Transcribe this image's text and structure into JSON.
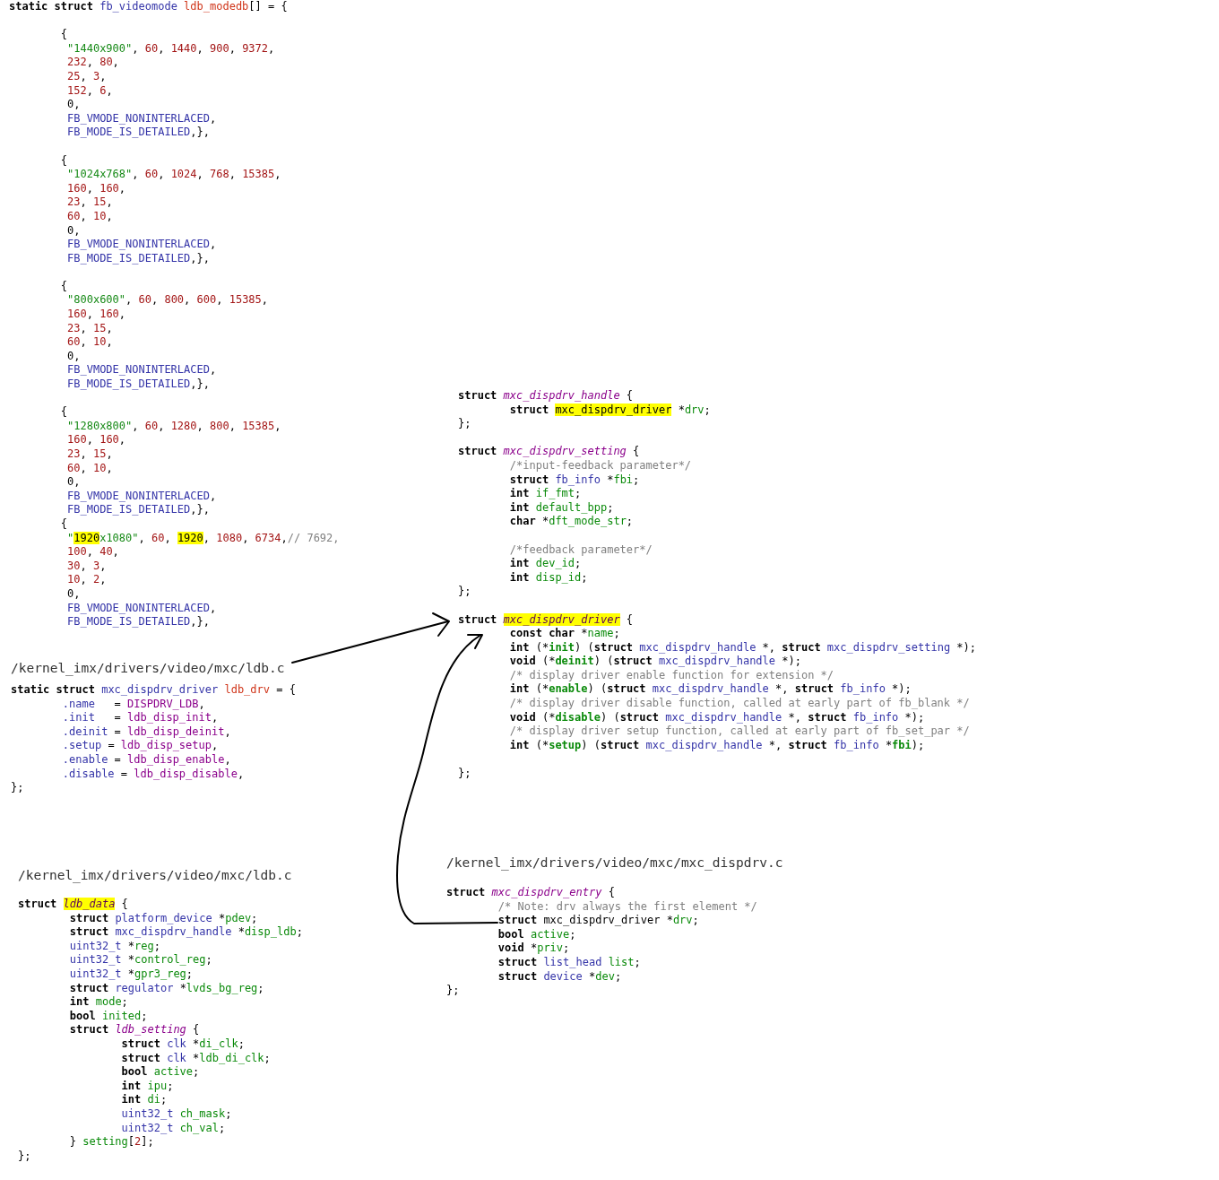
{
  "snippets": [
    {
      "groups": [
        [
          [
            {
              "text": "static struct ",
              "kind": "kw"
            },
            {
              "text": "fb_videomode ",
              "kind": "type"
            },
            {
              "text": "ldb_modedb",
              "kind": "decl"
            },
            {
              "text": "[] = {",
              "kind": "plain"
            }
          ]
        ],
        [
          [
            {
              "text": "        {",
              "kind": "plain"
            }
          ],
          [
            {
              "text": "         \"1440x900\"",
              "kind": "str"
            },
            {
              "text": ", ",
              "kind": "plain"
            },
            {
              "text": "60",
              "kind": "num"
            },
            {
              "text": ", ",
              "kind": "plain"
            },
            {
              "text": "1440",
              "kind": "num"
            },
            {
              "text": ", ",
              "kind": "plain"
            },
            {
              "text": "900",
              "kind": "num"
            },
            {
              "text": ", ",
              "kind": "plain"
            },
            {
              "text": "9372",
              "kind": "num"
            },
            {
              "text": ",",
              "kind": "plain"
            }
          ],
          [
            {
              "text": "         232",
              "kind": "num"
            },
            {
              "text": ", ",
              "kind": "plain"
            },
            {
              "text": "80",
              "kind": "num"
            },
            {
              "text": ",",
              "kind": "plain"
            }
          ],
          [
            {
              "text": "         25",
              "kind": "num"
            },
            {
              "text": ", ",
              "kind": "plain"
            },
            {
              "text": "3",
              "kind": "num"
            },
            {
              "text": ",",
              "kind": "plain"
            }
          ],
          [
            {
              "text": "         152",
              "kind": "num"
            },
            {
              "text": ", ",
              "kind": "plain"
            },
            {
              "text": "6",
              "kind": "num"
            },
            {
              "text": ",",
              "kind": "plain"
            }
          ],
          [
            {
              "text": "         0,",
              "kind": "plain"
            }
          ],
          [
            {
              "text": "         FB_VMODE_NONINTERLACED",
              "kind": "macro"
            },
            {
              "text": ",",
              "kind": "plain"
            }
          ],
          [
            {
              "text": "         FB_MODE_IS_DETAILED",
              "kind": "macro"
            },
            {
              "text": ",},",
              "kind": "plain"
            }
          ]
        ],
        [
          [
            {
              "text": "        {",
              "kind": "plain"
            }
          ],
          [
            {
              "text": "         \"1024x768\"",
              "kind": "str"
            },
            {
              "text": ", ",
              "kind": "plain"
            },
            {
              "text": "60",
              "kind": "num"
            },
            {
              "text": ", ",
              "kind": "plain"
            },
            {
              "text": "1024",
              "kind": "num"
            },
            {
              "text": ", ",
              "kind": "plain"
            },
            {
              "text": "768",
              "kind": "num"
            },
            {
              "text": ", ",
              "kind": "plain"
            },
            {
              "text": "15385",
              "kind": "num"
            },
            {
              "text": ",",
              "kind": "plain"
            }
          ],
          [
            {
              "text": "         160",
              "kind": "num"
            },
            {
              "text": ", ",
              "kind": "plain"
            },
            {
              "text": "160",
              "kind": "num"
            },
            {
              "text": ",",
              "kind": "plain"
            }
          ],
          [
            {
              "text": "         23",
              "kind": "num"
            },
            {
              "text": ", ",
              "kind": "plain"
            },
            {
              "text": "15",
              "kind": "num"
            },
            {
              "text": ",",
              "kind": "plain"
            }
          ],
          [
            {
              "text": "         60",
              "kind": "num"
            },
            {
              "text": ", ",
              "kind": "plain"
            },
            {
              "text": "10",
              "kind": "num"
            },
            {
              "text": ",",
              "kind": "plain"
            }
          ],
          [
            {
              "text": "         0,",
              "kind": "plain"
            }
          ],
          [
            {
              "text": "         FB_VMODE_NONINTERLACED",
              "kind": "macro"
            },
            {
              "text": ",",
              "kind": "plain"
            }
          ],
          [
            {
              "text": "         FB_MODE_IS_DETAILED",
              "kind": "macro"
            },
            {
              "text": ",},",
              "kind": "plain"
            }
          ]
        ],
        [
          [
            {
              "text": "        {",
              "kind": "plain"
            }
          ],
          [
            {
              "text": "         \"800x600\"",
              "kind": "str"
            },
            {
              "text": ", ",
              "kind": "plain"
            },
            {
              "text": "60",
              "kind": "num"
            },
            {
              "text": ", ",
              "kind": "plain"
            },
            {
              "text": "800",
              "kind": "num"
            },
            {
              "text": ", ",
              "kind": "plain"
            },
            {
              "text": "600",
              "kind": "num"
            },
            {
              "text": ", ",
              "kind": "plain"
            },
            {
              "text": "15385",
              "kind": "num"
            },
            {
              "text": ",",
              "kind": "plain"
            }
          ],
          [
            {
              "text": "         160",
              "kind": "num"
            },
            {
              "text": ", ",
              "kind": "plain"
            },
            {
              "text": "160",
              "kind": "num"
            },
            {
              "text": ",",
              "kind": "plain"
            }
          ],
          [
            {
              "text": "         23",
              "kind": "num"
            },
            {
              "text": ", ",
              "kind": "plain"
            },
            {
              "text": "15",
              "kind": "num"
            },
            {
              "text": ",",
              "kind": "plain"
            }
          ],
          [
            {
              "text": "         60",
              "kind": "num"
            },
            {
              "text": ", ",
              "kind": "plain"
            },
            {
              "text": "10",
              "kind": "num"
            },
            {
              "text": ",",
              "kind": "plain"
            }
          ],
          [
            {
              "text": "         0,",
              "kind": "plain"
            }
          ],
          [
            {
              "text": "         FB_VMODE_NONINTERLACED",
              "kind": "macro"
            },
            {
              "text": ",",
              "kind": "plain"
            }
          ],
          [
            {
              "text": "         FB_MODE_IS_DETAILED",
              "kind": "macro"
            },
            {
              "text": ",},",
              "kind": "plain"
            }
          ]
        ],
        [
          [
            {
              "text": "        {",
              "kind": "plain"
            }
          ],
          [
            {
              "text": "         \"1280x800\"",
              "kind": "str"
            },
            {
              "text": ", ",
              "kind": "plain"
            },
            {
              "text": "60",
              "kind": "num"
            },
            {
              "text": ", ",
              "kind": "plain"
            },
            {
              "text": "1280",
              "kind": "num"
            },
            {
              "text": ", ",
              "kind": "plain"
            },
            {
              "text": "800",
              "kind": "num"
            },
            {
              "text": ", ",
              "kind": "plain"
            },
            {
              "text": "15385",
              "kind": "num"
            },
            {
              "text": ",",
              "kind": "plain"
            }
          ],
          [
            {
              "text": "         160",
              "kind": "num"
            },
            {
              "text": ", ",
              "kind": "plain"
            },
            {
              "text": "160",
              "kind": "num"
            },
            {
              "text": ",",
              "kind": "plain"
            }
          ],
          [
            {
              "text": "         23",
              "kind": "num"
            },
            {
              "text": ", ",
              "kind": "plain"
            },
            {
              "text": "15",
              "kind": "num"
            },
            {
              "text": ",",
              "kind": "plain"
            }
          ],
          [
            {
              "text": "         60",
              "kind": "num"
            },
            {
              "text": ", ",
              "kind": "plain"
            },
            {
              "text": "10",
              "kind": "num"
            },
            {
              "text": ",",
              "kind": "plain"
            }
          ],
          [
            {
              "text": "         0,",
              "kind": "plain"
            }
          ],
          [
            {
              "text": "         FB_VMODE_NONINTERLACED",
              "kind": "macro"
            },
            {
              "text": ",",
              "kind": "plain"
            }
          ],
          [
            {
              "text": "         FB_MODE_IS_DETAILED",
              "kind": "macro"
            },
            {
              "text": ",},",
              "kind": "plain"
            }
          ],
          [
            {
              "text": "        {",
              "kind": "plain"
            }
          ],
          [
            {
              "text": "         \"",
              "kind": "str"
            },
            {
              "text": "1920",
              "kind": "hl"
            },
            {
              "text": "x1080\"",
              "kind": "str"
            },
            {
              "text": ", ",
              "kind": "plain"
            },
            {
              "text": "60",
              "kind": "num"
            },
            {
              "text": ", ",
              "kind": "plain"
            },
            {
              "text": "1920",
              "kind": "hl"
            },
            {
              "text": ", ",
              "kind": "plain"
            },
            {
              "text": "1080",
              "kind": "num"
            },
            {
              "text": ", ",
              "kind": "plain"
            },
            {
              "text": "6734",
              "kind": "num"
            },
            {
              "text": ",",
              "kind": "plain"
            },
            {
              "text": "// 7692,",
              "kind": "comment"
            }
          ],
          [
            {
              "text": "         100",
              "kind": "num"
            },
            {
              "text": ", ",
              "kind": "plain"
            },
            {
              "text": "40",
              "kind": "num"
            },
            {
              "text": ",",
              "kind": "plain"
            }
          ],
          [
            {
              "text": "         30",
              "kind": "num"
            },
            {
              "text": ", ",
              "kind": "plain"
            },
            {
              "text": "3",
              "kind": "num"
            },
            {
              "text": ",",
              "kind": "plain"
            }
          ],
          [
            {
              "text": "         10",
              "kind": "num"
            },
            {
              "text": ", ",
              "kind": "plain"
            },
            {
              "text": "2",
              "kind": "num"
            },
            {
              "text": ",",
              "kind": "plain"
            }
          ],
          [
            {
              "text": "         0,",
              "kind": "plain"
            }
          ],
          [
            {
              "text": "         FB_VMODE_NONINTERLACED",
              "kind": "macro"
            },
            {
              "text": ",",
              "kind": "plain"
            }
          ],
          [
            {
              "text": "         FB_MODE_IS_DETAILED",
              "kind": "macro"
            },
            {
              "text": ",},",
              "kind": "plain"
            }
          ]
        ]
      ]
    },
    {
      "groups": [
        [
          [
            {
              "text": "struct ",
              "kind": "kw"
            },
            {
              "text": "mxc_dispdrv_handle",
              "kind": "name"
            },
            {
              "text": " {",
              "kind": "plain"
            }
          ],
          [
            {
              "text": "        struct ",
              "kind": "kw"
            },
            {
              "text": "mxc_dispdrv_driver",
              "kind": "hl"
            },
            {
              "text": " *",
              "kind": "plain"
            },
            {
              "text": "drv",
              "kind": "var"
            },
            {
              "text": ";",
              "kind": "plain"
            }
          ],
          [
            {
              "text": "};",
              "kind": "plain"
            }
          ]
        ],
        [
          [
            {
              "text": "struct ",
              "kind": "kw"
            },
            {
              "text": "mxc_dispdrv_setting",
              "kind": "name"
            },
            {
              "text": " {",
              "kind": "plain"
            }
          ],
          [
            {
              "text": "        /*input-feedback parameter*/",
              "kind": "comment"
            }
          ],
          [
            {
              "text": "        struct ",
              "kind": "kw"
            },
            {
              "text": "fb_info",
              "kind": "type"
            },
            {
              "text": " *",
              "kind": "plain"
            },
            {
              "text": "fbi",
              "kind": "var"
            },
            {
              "text": ";",
              "kind": "plain"
            }
          ],
          [
            {
              "text": "        int ",
              "kind": "kw"
            },
            {
              "text": "if_fmt",
              "kind": "var"
            },
            {
              "text": ";",
              "kind": "plain"
            }
          ],
          [
            {
              "text": "        int ",
              "kind": "kw"
            },
            {
              "text": "default_bpp",
              "kind": "var"
            },
            {
              "text": ";",
              "kind": "plain"
            }
          ],
          [
            {
              "text": "        char ",
              "kind": "kw"
            },
            {
              "text": "*",
              "kind": "plain"
            },
            {
              "text": "dft_mode_str",
              "kind": "var"
            },
            {
              "text": ";",
              "kind": "plain"
            }
          ]
        ],
        [
          [
            {
              "text": "        /*feedback parameter*/",
              "kind": "comment"
            }
          ],
          [
            {
              "text": "        int ",
              "kind": "kw"
            },
            {
              "text": "dev_id",
              "kind": "var"
            },
            {
              "text": ";",
              "kind": "plain"
            }
          ],
          [
            {
              "text": "        int ",
              "kind": "kw"
            },
            {
              "text": "disp_id",
              "kind": "var"
            },
            {
              "text": ";",
              "kind": "plain"
            }
          ],
          [
            {
              "text": "};",
              "kind": "plain"
            }
          ]
        ],
        [
          [
            {
              "text": "struct ",
              "kind": "kw"
            },
            {
              "text": "mxc_dispdrv_driver",
              "kind": "namehl"
            },
            {
              "text": " {",
              "kind": "plain"
            }
          ],
          [
            {
              "text": "        const char ",
              "kind": "kw"
            },
            {
              "text": "*",
              "kind": "plain"
            },
            {
              "text": "name",
              "kind": "var"
            },
            {
              "text": ";",
              "kind": "plain"
            }
          ],
          [
            {
              "text": "        int ",
              "kind": "kw"
            },
            {
              "text": "(*",
              "kind": "plain"
            },
            {
              "text": "init",
              "kind": "fnptr"
            },
            {
              "text": ") (",
              "kind": "plain"
            },
            {
              "text": "struct ",
              "kind": "kw"
            },
            {
              "text": "mxc_dispdrv_handle",
              "kind": "type"
            },
            {
              "text": " *, ",
              "kind": "plain"
            },
            {
              "text": "struct ",
              "kind": "kw"
            },
            {
              "text": "mxc_dispdrv_setting",
              "kind": "type"
            },
            {
              "text": " *);",
              "kind": "plain"
            }
          ],
          [
            {
              "text": "        void ",
              "kind": "kw"
            },
            {
              "text": "(*",
              "kind": "plain"
            },
            {
              "text": "deinit",
              "kind": "fnptr"
            },
            {
              "text": ") (",
              "kind": "plain"
            },
            {
              "text": "struct ",
              "kind": "kw"
            },
            {
              "text": "mxc_dispdrv_handle",
              "kind": "type"
            },
            {
              "text": " *);",
              "kind": "plain"
            }
          ],
          [
            {
              "text": "        /* display driver enable function for extension */",
              "kind": "comment"
            }
          ],
          [
            {
              "text": "        int ",
              "kind": "kw"
            },
            {
              "text": "(*",
              "kind": "plain"
            },
            {
              "text": "enable",
              "kind": "fnptr"
            },
            {
              "text": ") (",
              "kind": "plain"
            },
            {
              "text": "struct ",
              "kind": "kw"
            },
            {
              "text": "mxc_dispdrv_handle",
              "kind": "type"
            },
            {
              "text": " *, ",
              "kind": "plain"
            },
            {
              "text": "struct ",
              "kind": "kw"
            },
            {
              "text": "fb_info",
              "kind": "type"
            },
            {
              "text": " *);",
              "kind": "plain"
            }
          ],
          [
            {
              "text": "        /* display driver disable function, called at early part of fb_blank */",
              "kind": "comment"
            }
          ],
          [
            {
              "text": "        void ",
              "kind": "kw"
            },
            {
              "text": "(*",
              "kind": "plain"
            },
            {
              "text": "disable",
              "kind": "fnptr"
            },
            {
              "text": ") (",
              "kind": "plain"
            },
            {
              "text": "struct ",
              "kind": "kw"
            },
            {
              "text": "mxc_dispdrv_handle",
              "kind": "type"
            },
            {
              "text": " *, ",
              "kind": "plain"
            },
            {
              "text": "struct ",
              "kind": "kw"
            },
            {
              "text": "fb_info",
              "kind": "type"
            },
            {
              "text": " *);",
              "kind": "plain"
            }
          ],
          [
            {
              "text": "        /* display driver setup function, called at early part of fb_set_par */",
              "kind": "comment"
            }
          ],
          [
            {
              "text": "        int ",
              "kind": "kw"
            },
            {
              "text": "(*",
              "kind": "plain"
            },
            {
              "text": "setup",
              "kind": "fnptr"
            },
            {
              "text": ") (",
              "kind": "plain"
            },
            {
              "text": "struct ",
              "kind": "kw"
            },
            {
              "text": "mxc_dispdrv_handle",
              "kind": "type"
            },
            {
              "text": " *, ",
              "kind": "plain"
            },
            {
              "text": "struct ",
              "kind": "kw"
            },
            {
              "text": "fb_info",
              "kind": "type"
            },
            {
              "text": " *",
              "kind": "plain"
            },
            {
              "text": "fbi",
              "kind": "fnptr"
            },
            {
              "text": ");",
              "kind": "plain"
            }
          ]
        ],
        [
          [
            {
              "text": "};",
              "kind": "plain"
            }
          ]
        ]
      ]
    },
    {
      "path": "/kernel_imx/drivers/video/mxc/ldb.c",
      "groups": [
        [
          [
            {
              "text": "static struct ",
              "kind": "kw"
            },
            {
              "text": "mxc_dispdrv_driver ",
              "kind": "type"
            },
            {
              "text": "ldb_drv",
              "kind": "decl"
            },
            {
              "text": " = {",
              "kind": "plain"
            }
          ],
          [
            {
              "text": "        .name",
              "kind": "member"
            },
            {
              "text": "   = ",
              "kind": "plain"
            },
            {
              "text": "DISPDRV_LDB",
              "kind": "fn"
            },
            {
              "text": ",",
              "kind": "plain"
            }
          ],
          [
            {
              "text": "        .init",
              "kind": "member"
            },
            {
              "text": "   = ",
              "kind": "plain"
            },
            {
              "text": "ldb_disp_init",
              "kind": "fn"
            },
            {
              "text": ",",
              "kind": "plain"
            }
          ],
          [
            {
              "text": "        .deinit",
              "kind": "member"
            },
            {
              "text": " = ",
              "kind": "plain"
            },
            {
              "text": "ldb_disp_deinit",
              "kind": "fn"
            },
            {
              "text": ",",
              "kind": "plain"
            }
          ],
          [
            {
              "text": "        .setup",
              "kind": "member"
            },
            {
              "text": " = ",
              "kind": "plain"
            },
            {
              "text": "ldb_disp_setup",
              "kind": "fn"
            },
            {
              "text": ",",
              "kind": "plain"
            }
          ],
          [
            {
              "text": "        .enable",
              "kind": "member"
            },
            {
              "text": " = ",
              "kind": "plain"
            },
            {
              "text": "ldb_disp_enable",
              "kind": "fn"
            },
            {
              "text": ",",
              "kind": "plain"
            }
          ],
          [
            {
              "text": "        .disable",
              "kind": "member"
            },
            {
              "text": " = ",
              "kind": "plain"
            },
            {
              "text": "ldb_disp_disable",
              "kind": "fn"
            },
            {
              "text": ",",
              "kind": "plain"
            }
          ],
          [
            {
              "text": "};",
              "kind": "plain"
            }
          ]
        ]
      ]
    },
    {
      "path": "/kernel_imx/drivers/video/mxc/ldb.c",
      "groups": [
        [
          [
            {
              "text": "struct ",
              "kind": "kw"
            },
            {
              "text": "ldb_data",
              "kind": "namehl"
            },
            {
              "text": " {",
              "kind": "plain"
            }
          ],
          [
            {
              "text": "        struct ",
              "kind": "kw"
            },
            {
              "text": "platform_device",
              "kind": "type"
            },
            {
              "text": " *",
              "kind": "plain"
            },
            {
              "text": "pdev",
              "kind": "var"
            },
            {
              "text": ";",
              "kind": "plain"
            }
          ],
          [
            {
              "text": "        struct ",
              "kind": "kw"
            },
            {
              "text": "mxc_dispdrv_handle",
              "kind": "type"
            },
            {
              "text": " *",
              "kind": "plain"
            },
            {
              "text": "disp_ldb",
              "kind": "var"
            },
            {
              "text": ";",
              "kind": "plain"
            }
          ],
          [
            {
              "text": "        uint32_t",
              "kind": "type"
            },
            {
              "text": " *",
              "kind": "plain"
            },
            {
              "text": "reg",
              "kind": "var"
            },
            {
              "text": ";",
              "kind": "plain"
            }
          ],
          [
            {
              "text": "        uint32_t",
              "kind": "type"
            },
            {
              "text": " *",
              "kind": "plain"
            },
            {
              "text": "control_reg",
              "kind": "var"
            },
            {
              "text": ";",
              "kind": "plain"
            }
          ],
          [
            {
              "text": "        uint32_t",
              "kind": "type"
            },
            {
              "text": " *",
              "kind": "plain"
            },
            {
              "text": "gpr3_reg",
              "kind": "var"
            },
            {
              "text": ";",
              "kind": "plain"
            }
          ],
          [
            {
              "text": "        struct ",
              "kind": "kw"
            },
            {
              "text": "regulator",
              "kind": "type"
            },
            {
              "text": " *",
              "kind": "plain"
            },
            {
              "text": "lvds_bg_reg",
              "kind": "var"
            },
            {
              "text": ";",
              "kind": "plain"
            }
          ],
          [
            {
              "text": "        int ",
              "kind": "kw"
            },
            {
              "text": "mode",
              "kind": "var"
            },
            {
              "text": ";",
              "kind": "plain"
            }
          ],
          [
            {
              "text": "        bool ",
              "kind": "kw"
            },
            {
              "text": "inited",
              "kind": "var"
            },
            {
              "text": ";",
              "kind": "plain"
            }
          ],
          [
            {
              "text": "        struct ",
              "kind": "kw"
            },
            {
              "text": "ldb_setting",
              "kind": "name"
            },
            {
              "text": " {",
              "kind": "plain"
            }
          ],
          [
            {
              "text": "                struct ",
              "kind": "kw"
            },
            {
              "text": "clk",
              "kind": "type"
            },
            {
              "text": " *",
              "kind": "plain"
            },
            {
              "text": "di_clk",
              "kind": "var"
            },
            {
              "text": ";",
              "kind": "plain"
            }
          ],
          [
            {
              "text": "                struct ",
              "kind": "kw"
            },
            {
              "text": "clk",
              "kind": "type"
            },
            {
              "text": " *",
              "kind": "plain"
            },
            {
              "text": "ldb_di_clk",
              "kind": "var"
            },
            {
              "text": ";",
              "kind": "plain"
            }
          ],
          [
            {
              "text": "                bool ",
              "kind": "kw"
            },
            {
              "text": "active",
              "kind": "var"
            },
            {
              "text": ";",
              "kind": "plain"
            }
          ],
          [
            {
              "text": "                int ",
              "kind": "kw"
            },
            {
              "text": "ipu",
              "kind": "var"
            },
            {
              "text": ";",
              "kind": "plain"
            }
          ],
          [
            {
              "text": "                int ",
              "kind": "kw"
            },
            {
              "text": "di",
              "kind": "var"
            },
            {
              "text": ";",
              "kind": "plain"
            }
          ],
          [
            {
              "text": "                uint32_t ",
              "kind": "type"
            },
            {
              "text": "ch_mask",
              "kind": "var"
            },
            {
              "text": ";",
              "kind": "plain"
            }
          ],
          [
            {
              "text": "                uint32_t ",
              "kind": "type"
            },
            {
              "text": "ch_val",
              "kind": "var"
            },
            {
              "text": ";",
              "kind": "plain"
            }
          ],
          [
            {
              "text": "        } ",
              "kind": "plain"
            },
            {
              "text": "setting",
              "kind": "var"
            },
            {
              "text": "[",
              "kind": "plain"
            },
            {
              "text": "2",
              "kind": "num"
            },
            {
              "text": "];",
              "kind": "plain"
            }
          ],
          [
            {
              "text": "};",
              "kind": "plain"
            }
          ]
        ]
      ]
    },
    {
      "path": "/kernel_imx/drivers/video/mxc/mxc_dispdrv.c",
      "groups": [
        [
          [
            {
              "text": "struct ",
              "kind": "kw"
            },
            {
              "text": "mxc_dispdrv_entry",
              "kind": "name"
            },
            {
              "text": " {",
              "kind": "plain"
            }
          ],
          [
            {
              "text": "        /* Note: drv always the first element */",
              "kind": "comment"
            }
          ],
          [
            {
              "text": "        struct ",
              "kind": "kw"
            },
            {
              "text": "mxc_dispdrv_driver *",
              "kind": "plain"
            },
            {
              "text": "drv",
              "kind": "var"
            },
            {
              "text": ";",
              "kind": "plain"
            }
          ],
          [
            {
              "text": "        bool ",
              "kind": "kw"
            },
            {
              "text": "active",
              "kind": "var"
            },
            {
              "text": ";",
              "kind": "plain"
            }
          ],
          [
            {
              "text": "        void ",
              "kind": "kw"
            },
            {
              "text": "*",
              "kind": "plain"
            },
            {
              "text": "priv",
              "kind": "var"
            },
            {
              "text": ";",
              "kind": "plain"
            }
          ],
          [
            {
              "text": "        struct ",
              "kind": "kw"
            },
            {
              "text": "list_head ",
              "kind": "type"
            },
            {
              "text": "list",
              "kind": "var"
            },
            {
              "text": ";",
              "kind": "plain"
            }
          ],
          [
            {
              "text": "        struct ",
              "kind": "kw"
            },
            {
              "text": "device",
              "kind": "type"
            },
            {
              "text": " *",
              "kind": "plain"
            },
            {
              "text": "dev",
              "kind": "var"
            },
            {
              "text": ";",
              "kind": "plain"
            }
          ],
          [
            {
              "text": "};",
              "kind": "plain"
            }
          ]
        ]
      ]
    }
  ]
}
